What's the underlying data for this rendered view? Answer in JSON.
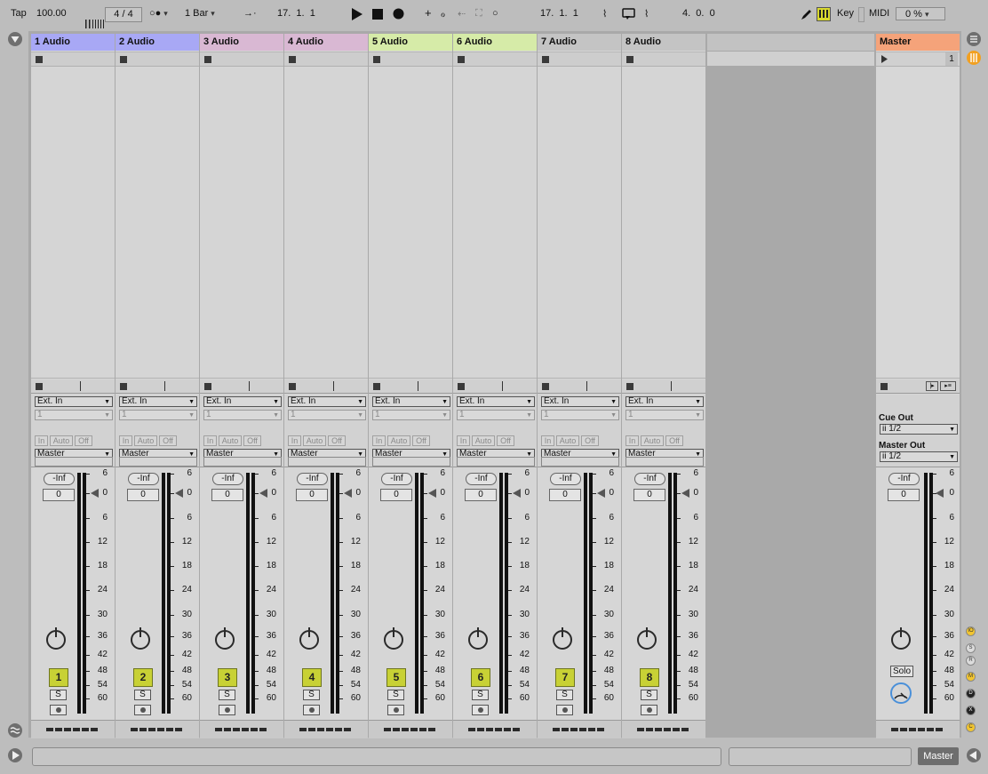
{
  "toolbar": {
    "tap": "Tap",
    "tempo": "100.00",
    "signature": "4 / 4",
    "quantize": "1 Bar",
    "arrangement_position": "17.  1.  1",
    "loop_start": "17.  1.  1",
    "loop_length": "4.  0.  0",
    "key_label": "Key",
    "midi_label": "MIDI",
    "cpu": "0 %"
  },
  "tracks": [
    {
      "name": "1 Audio",
      "color": "#a8a8f5",
      "num": "1"
    },
    {
      "name": "2 Audio",
      "color": "#a8a8f5",
      "num": "2"
    },
    {
      "name": "3 Audio",
      "color": "#d9b8d3",
      "num": "3"
    },
    {
      "name": "4 Audio",
      "color": "#d9b8d3",
      "num": "4"
    },
    {
      "name": "5 Audio",
      "color": "#d6eba8",
      "num": "5"
    },
    {
      "name": "6 Audio",
      "color": "#d6eba8",
      "num": "6"
    },
    {
      "name": "7 Audio",
      "color": "#c4c4c4",
      "num": "7"
    },
    {
      "name": "8 Audio",
      "color": "#c4c4c4",
      "num": "8"
    }
  ],
  "io": {
    "input_type": "Ext. In",
    "input_channel": "1",
    "monitor": [
      "In",
      "Auto",
      "Off"
    ],
    "output": "Master"
  },
  "mixer": {
    "send": "-Inf",
    "volume": "0",
    "scale": [
      "6",
      "0",
      "6",
      "12",
      "18",
      "24",
      "30",
      "36",
      "42",
      "48",
      "54",
      "60"
    ],
    "solo": "S"
  },
  "master": {
    "name": "Master",
    "color": "#f5a37a",
    "scene": "1",
    "cue_out_label": "Cue Out",
    "cue_out": "ii 1/2",
    "master_out_label": "Master Out",
    "master_out": "ii 1/2",
    "solo": "Solo"
  },
  "status": {
    "selected_track": "Master"
  },
  "side_icons": [
    {
      "name": "io-icon",
      "label": "IO",
      "color": "#f2c530"
    },
    {
      "name": "sends-icon",
      "label": "S",
      "color": "#dcdcdc"
    },
    {
      "name": "returns-icon",
      "label": "R",
      "color": "#dcdcdc"
    },
    {
      "name": "mixer-icon",
      "label": "M",
      "color": "#f2c530"
    },
    {
      "name": "delay-icon",
      "label": "D",
      "color": "#222222"
    },
    {
      "name": "crossfade-icon",
      "label": "X",
      "color": "#222222"
    },
    {
      "name": "cue-icon",
      "label": "C",
      "color": "#f2c530"
    }
  ]
}
